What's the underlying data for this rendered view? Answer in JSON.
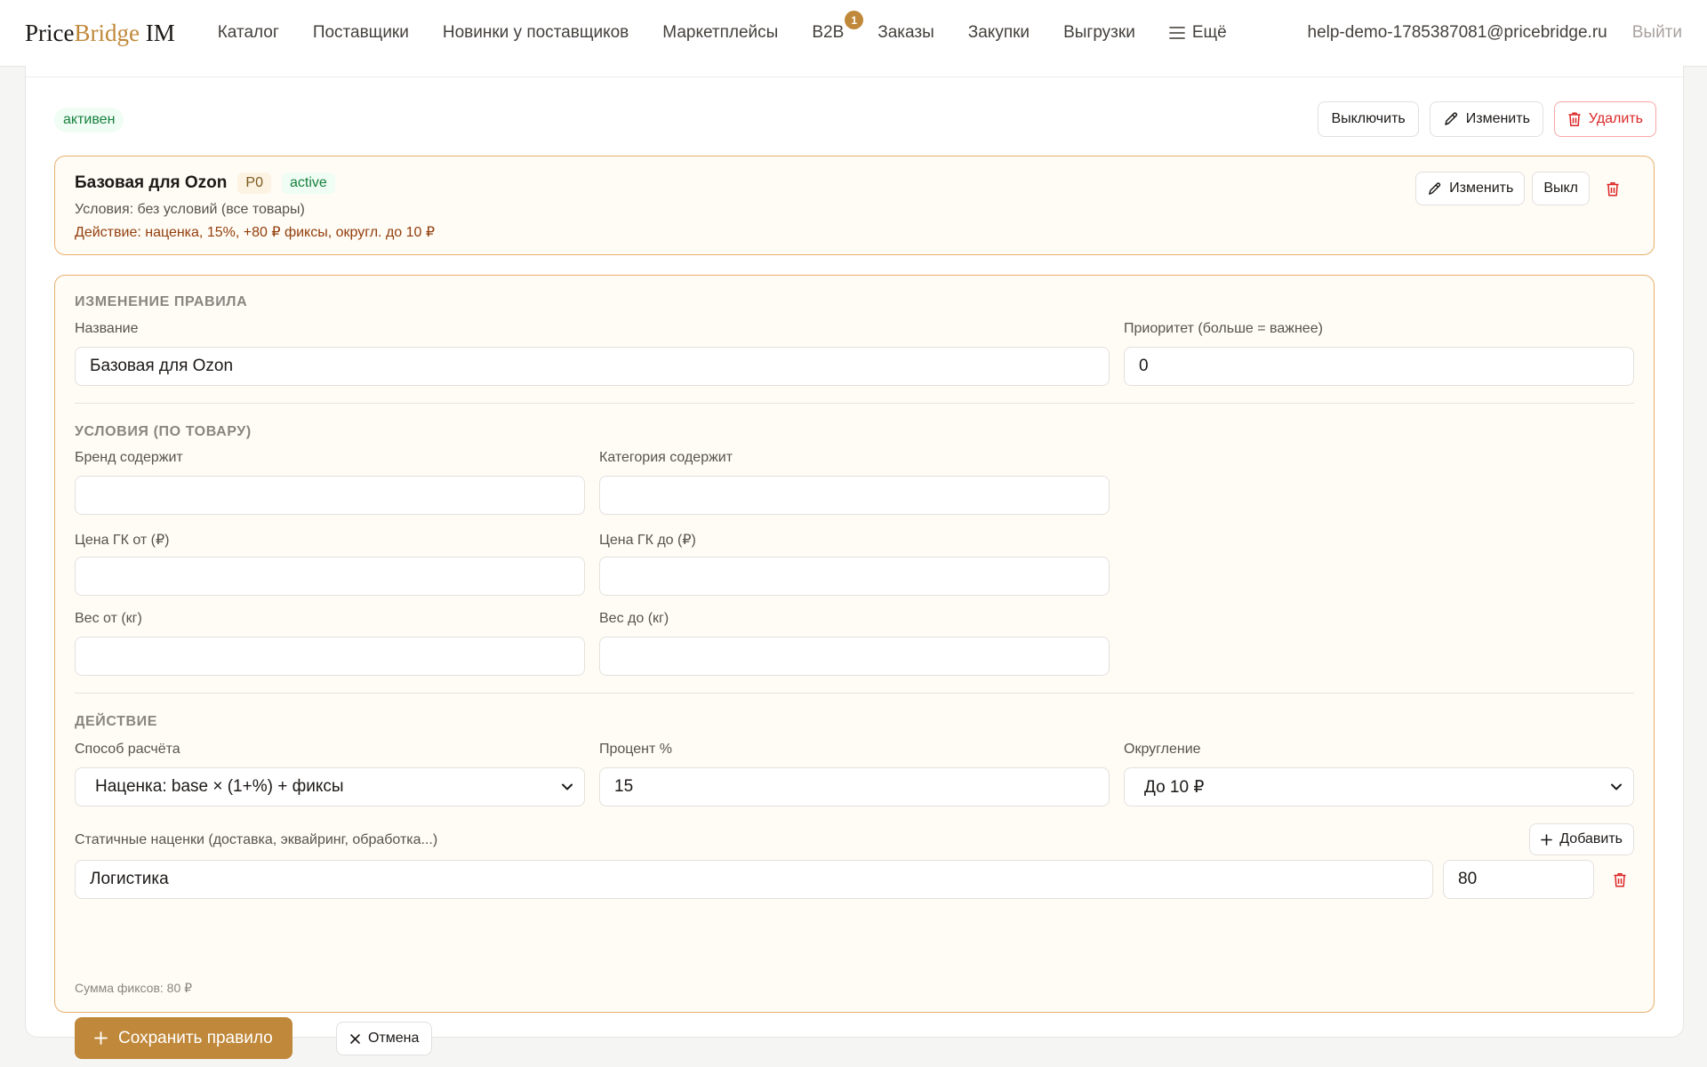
{
  "nav": {
    "logo_part1": "Price",
    "logo_part2": "Bridge",
    "logo_part3": " IM",
    "items": [
      {
        "label": "Каталог"
      },
      {
        "label": "Поставщики"
      },
      {
        "label": "Новинки у поставщиков"
      },
      {
        "label": "Маркетплейсы"
      },
      {
        "label": "B2B",
        "badge": "1"
      },
      {
        "label": "Заказы"
      },
      {
        "label": "Закупки"
      },
      {
        "label": "Выгрузки"
      }
    ],
    "more_label": "Ещё",
    "email": "help-demo-1785387081@pricebridge.ru",
    "logout": "Выйти"
  },
  "header": {
    "status": "активен",
    "disable_button": "Выключить",
    "edit_button": "Изменить",
    "delete_button": "Удалить"
  },
  "rule": {
    "title": "Базовая для Ozon",
    "priority_tag": "P0",
    "status_tag": "active",
    "conditions": "Условия: без условий (все товары)",
    "action": "Действие: наценка, 15%, +80 ₽ фиксы, округл. до 10 ₽",
    "edit_button": "Изменить",
    "off_button": "Выкл"
  },
  "form": {
    "section_title": "Изменение правила",
    "name_label": "Название",
    "name_value": "Базовая для Ozon",
    "priority_label": "Приоритет (больше = важнее)",
    "priority_value": "0",
    "conditions_title": "Условия (по товару)",
    "brand_label": "Бренд содержит",
    "brand_value": "",
    "category_label": "Категория содержит",
    "category_value": "",
    "price_from_label": "Цена ГК от (₽)",
    "price_from_value": "",
    "price_to_label": "Цена ГК до (₽)",
    "price_to_value": "",
    "weight_from_label": "Вес от (кг)",
    "weight_from_value": "",
    "weight_to_label": "Вес до (кг)",
    "weight_to_value": "",
    "action_title": "Действие",
    "method_label": "Способ расчёта",
    "method_value": "Наценка: base × (1+%) + фиксы",
    "percent_label": "Процент %",
    "percent_value": "15",
    "rounding_label": "Округление",
    "rounding_value": "До 10 ₽",
    "static_label": "Статичные наценки (доставка, эквайринг, обработка...)",
    "add_button": "Добавить",
    "fee_name": "Логистика",
    "fee_value": "80",
    "fee_sum": "Сумма фиксов: 80 ₽",
    "save_button": "Сохранить правило",
    "cancel_button": "Отмена"
  },
  "colors": {
    "accent": "#c0883a",
    "danger": "#dc2626",
    "success": "#15803d"
  }
}
